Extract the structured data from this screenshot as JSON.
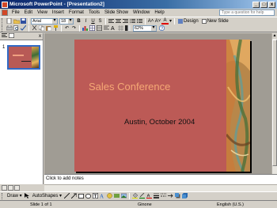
{
  "window": {
    "title": "Microsoft PowerPoint - [Presentation2]",
    "min_label": "_",
    "max_label": "□",
    "close_label": "x"
  },
  "menu": {
    "items": [
      "File",
      "Edit",
      "View",
      "Insert",
      "Format",
      "Tools",
      "Slide Show",
      "Window",
      "Help"
    ],
    "help_placeholder": "Type a question for help"
  },
  "formatting": {
    "font_name": "Arial",
    "font_size": "18",
    "bold_label": "B",
    "italic_label": "I",
    "underline_label": "U",
    "shadow_label": "S",
    "grow_font_label": "A˄",
    "shrink_font_label": "A˅",
    "font_color_label": "A",
    "design_label": "Design",
    "new_slide_label": "New Slide"
  },
  "standard": {
    "zoom": "62%"
  },
  "outline": {
    "slide_number": "1",
    "close_label": "x"
  },
  "slide": {
    "title": "Sales Conference",
    "subtitle": "Austin, October 2004"
  },
  "notes": {
    "placeholder": "Click to add notes"
  },
  "drawing": {
    "draw_label": "Draw ▾",
    "autoshapes_label": "AutoShapes ▾"
  },
  "status": {
    "slide_position": "Slide 1 of 1",
    "design_name": "Ginone",
    "language": "English (U.S.)"
  },
  "colors": {
    "slide_background": "#bc5a56",
    "slide_title": "#f5a875",
    "title_bar": "#0a246a"
  }
}
